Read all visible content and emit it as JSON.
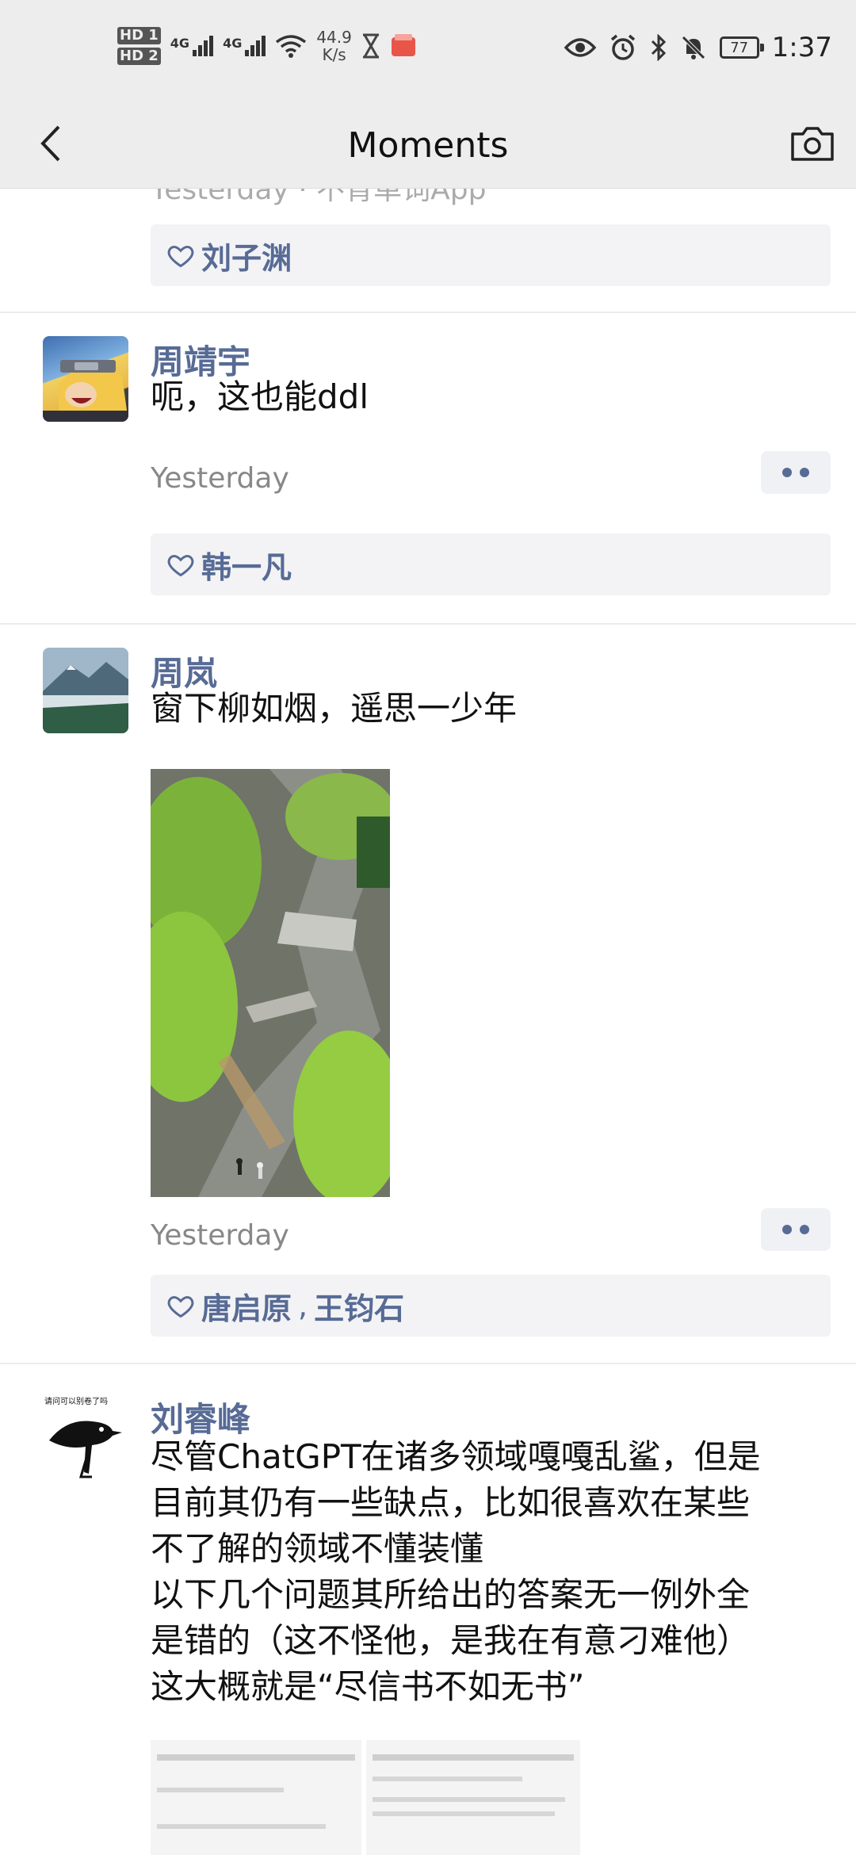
{
  "status_bar": {
    "hd1": "HD 1",
    "hd2": "HD 2",
    "signal1": "4G",
    "signal2": "4G",
    "speed_value": "44.9",
    "speed_unit": "K/s",
    "battery": "77",
    "time": "1:37"
  },
  "header": {
    "title": "Moments"
  },
  "posts": [
    {
      "partial_ts": "Yesterday · 不背单词App",
      "likes": [
        "刘子渊"
      ]
    },
    {
      "author": "周靖宇",
      "text": "呃，这也能ddl",
      "timestamp": "Yesterday",
      "likes": [
        "韩一凡"
      ]
    },
    {
      "author": "周岚",
      "text": "窗下柳如烟，遥思一少年",
      "timestamp": "Yesterday",
      "likes": [
        "唐启原",
        "王钧石"
      ],
      "like_separator": ","
    },
    {
      "author": "刘睿峰",
      "text_lines": [
        "尽管ChatGPT在诸多领域嘎嘎乱鲨，但是",
        "目前其仍有一些缺点，比如很喜欢在某些",
        "不了解的领域不懂装懂",
        "以下几个问题其所给出的答案无一例外全",
        "是错的（这不怪他，是我在有意刁难他）",
        "这大概就是“尽信书不如无书”"
      ],
      "avatar_caption": "请问可以别卷了吗"
    }
  ],
  "colors": {
    "name": "#576b95",
    "bar": "#ededed"
  },
  "icons": [
    "back-chevron-icon",
    "camera-icon",
    "heart-icon",
    "more-dots-icon"
  ]
}
